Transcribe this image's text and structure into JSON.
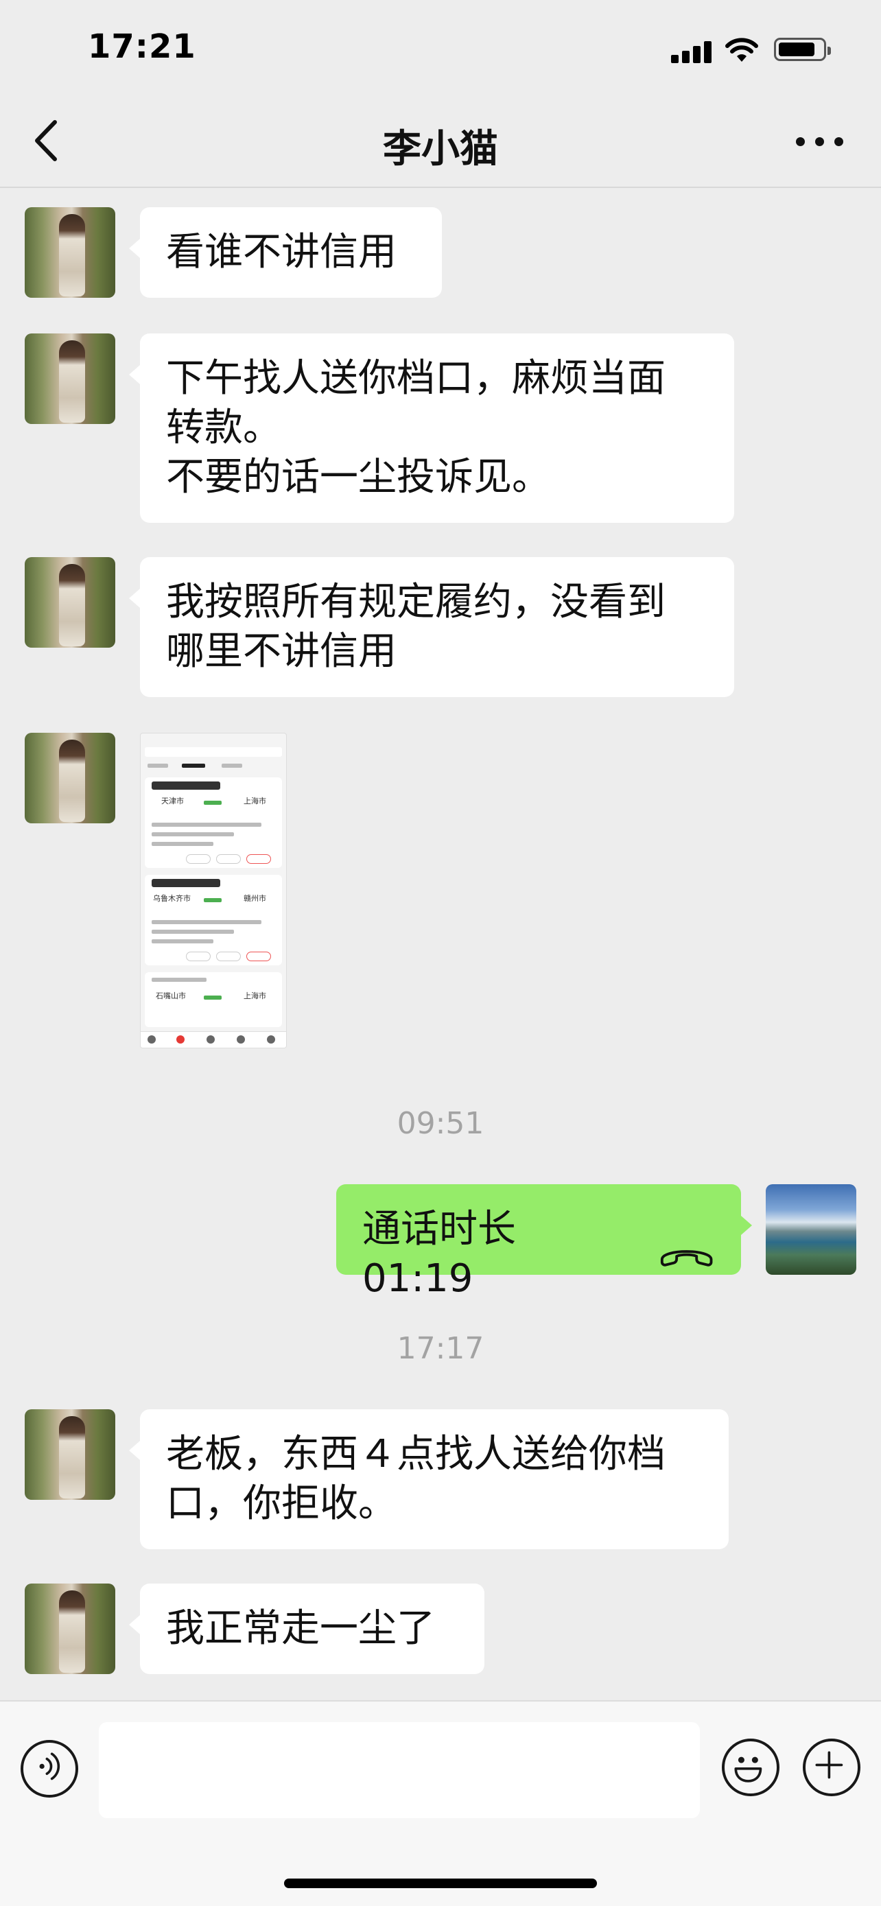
{
  "status_bar": {
    "time": "17:21",
    "icons": [
      "cellular-signal-icon",
      "wifi-icon",
      "battery-icon"
    ]
  },
  "nav": {
    "title": "李小猫",
    "back_icon": "chevron-left-icon",
    "more_icon": "more-horizontal-icon"
  },
  "messages": [
    {
      "from": "other",
      "text": "看谁不讲信用"
    },
    {
      "from": "other",
      "lines": [
        "下午找人送你档口，麻烦当面",
        "转款。",
        "不要的话一尘投诉见。"
      ]
    },
    {
      "from": "other",
      "lines": [
        "我按照所有规定履约，没看到",
        "哪里不讲信用"
      ]
    },
    {
      "from": "other",
      "type": "image",
      "image": {
        "cities": [
          {
            "from": "天津市",
            "to": "上海市"
          },
          {
            "from": "乌鲁木齐市",
            "to": "赣州市"
          },
          {
            "from": "石嘴山市",
            "to": "上海市"
          }
        ]
      }
    },
    {
      "type": "time",
      "text": "09:51"
    },
    {
      "from": "self",
      "type": "call",
      "text": "通话时长 01:19",
      "icon": "phone-hangup-icon"
    },
    {
      "type": "time",
      "text": "17:17"
    },
    {
      "from": "other",
      "lines": [
        "老板，东西４点找人送给你档",
        "口，你拒收。"
      ]
    },
    {
      "from": "other",
      "text": "我正常走一尘了"
    }
  ],
  "input_bar": {
    "voice_icon": "voice-input-icon",
    "emoji_icon": "emoji-icon",
    "plus_icon": "plus-circle-icon",
    "text_value": ""
  },
  "colors": {
    "background": "#ededed",
    "bubble_other": "#ffffff",
    "bubble_self": "#95ec69",
    "timestamp": "#a3a3a3"
  }
}
